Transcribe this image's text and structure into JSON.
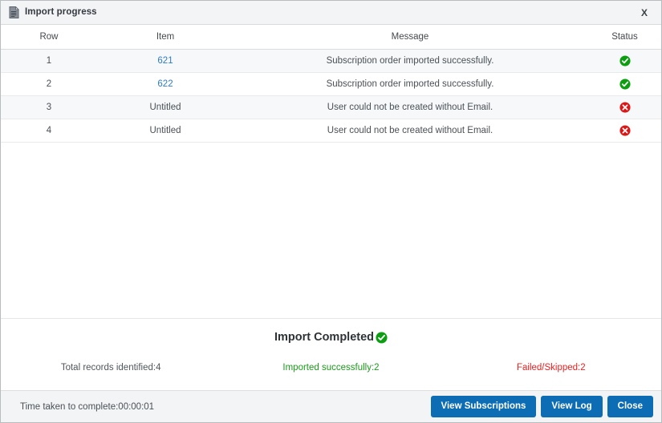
{
  "window": {
    "title": "Import progress",
    "icon": "document-icon",
    "close_label": "X"
  },
  "table": {
    "columns": [
      "Row",
      "Item",
      "Message",
      "Status"
    ],
    "rows": [
      {
        "row": "1",
        "item": "621",
        "item_is_link": true,
        "message": "Subscription order imported successfully.",
        "status": "success"
      },
      {
        "row": "2",
        "item": "622",
        "item_is_link": true,
        "message": "Subscription order imported successfully.",
        "status": "success"
      },
      {
        "row": "3",
        "item": "Untitled",
        "item_is_link": false,
        "message": "User could not be created without Email.",
        "status": "error"
      },
      {
        "row": "4",
        "item": "Untitled",
        "item_is_link": false,
        "message": "User could not be created without Email.",
        "status": "error"
      }
    ]
  },
  "summary": {
    "title": "Import Completed",
    "title_status": "success",
    "total": "Total records identified:4",
    "imported": "Imported successfully:2",
    "failed": "Failed/Skipped:2"
  },
  "footer": {
    "time_taken": "Time taken to complete:00:00:01",
    "buttons": [
      {
        "label": "View Subscriptions",
        "name": "view-subscriptions-button"
      },
      {
        "label": "View Log",
        "name": "view-log-button"
      },
      {
        "label": "Close",
        "name": "close-button"
      }
    ]
  },
  "colors": {
    "accent_blue": "#0c6db5",
    "link_blue": "#2f7cc2",
    "success_green": "#1a9c1a",
    "error_red": "#f01e1e",
    "titlebar_bg": "#f3f4f5",
    "row_stripe": "#f7f8f9"
  }
}
